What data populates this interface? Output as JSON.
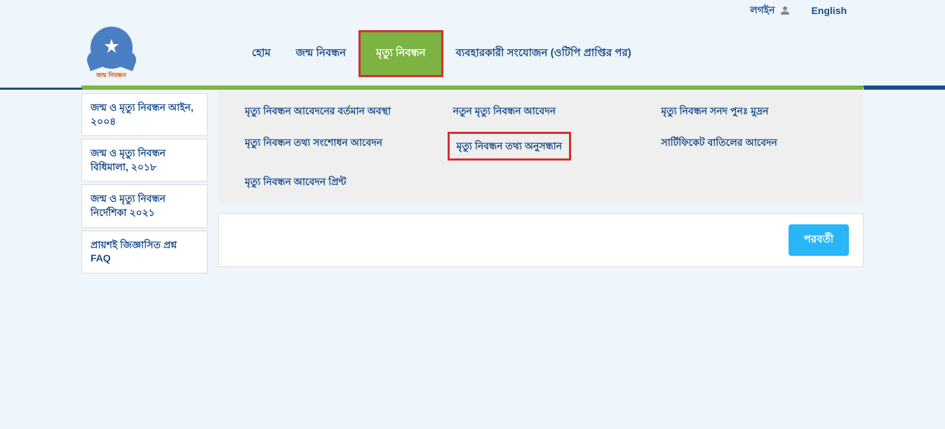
{
  "topbar": {
    "login": "লগইন",
    "language": "English"
  },
  "logo": {
    "caption": "জন্ম নিবন্ধন"
  },
  "nav": {
    "home": "হোম",
    "birth": "জন্ম নিবন্ধন",
    "death": "মৃত্যু নিবন্ধন",
    "user": "ব্যবহারকারী সংযোজন (ওটিপি প্রাপ্তির পর)"
  },
  "sidebar": {
    "items": [
      "জন্ম ও মৃত্যু নিবন্ধন আইন, ২০০৪",
      "জন্ম ও মৃত্যু নিবন্ধন বিধিমালা, ২০১৮",
      "জন্ম ও মৃত্যু নিবন্ধন নির্দেশিকা ২০২১",
      "প্রায়শই জিজ্ঞাসিত প্রশ্ন FAQ"
    ]
  },
  "dropdown": {
    "items": [
      "মৃত্যু নিবন্ধন আবেদনের বর্তমান অবস্থা",
      "নতুন মৃত্যু নিবন্ধন আবেদন",
      "মৃত্যু নিবন্ধন সনদ পুনঃ মুদ্রন",
      "মৃত্যু নিবন্ধন তথ্য সংশোধন আবেদন",
      "মৃত্যু নিবন্ধন তথ্য অনুসন্ধান",
      "সার্টিফিকেট বাতিলের আবেদন",
      "মৃত্যু নিবন্ধন আবেদন প্রিন্ট"
    ]
  },
  "buttons": {
    "next": "পরবর্তী"
  }
}
